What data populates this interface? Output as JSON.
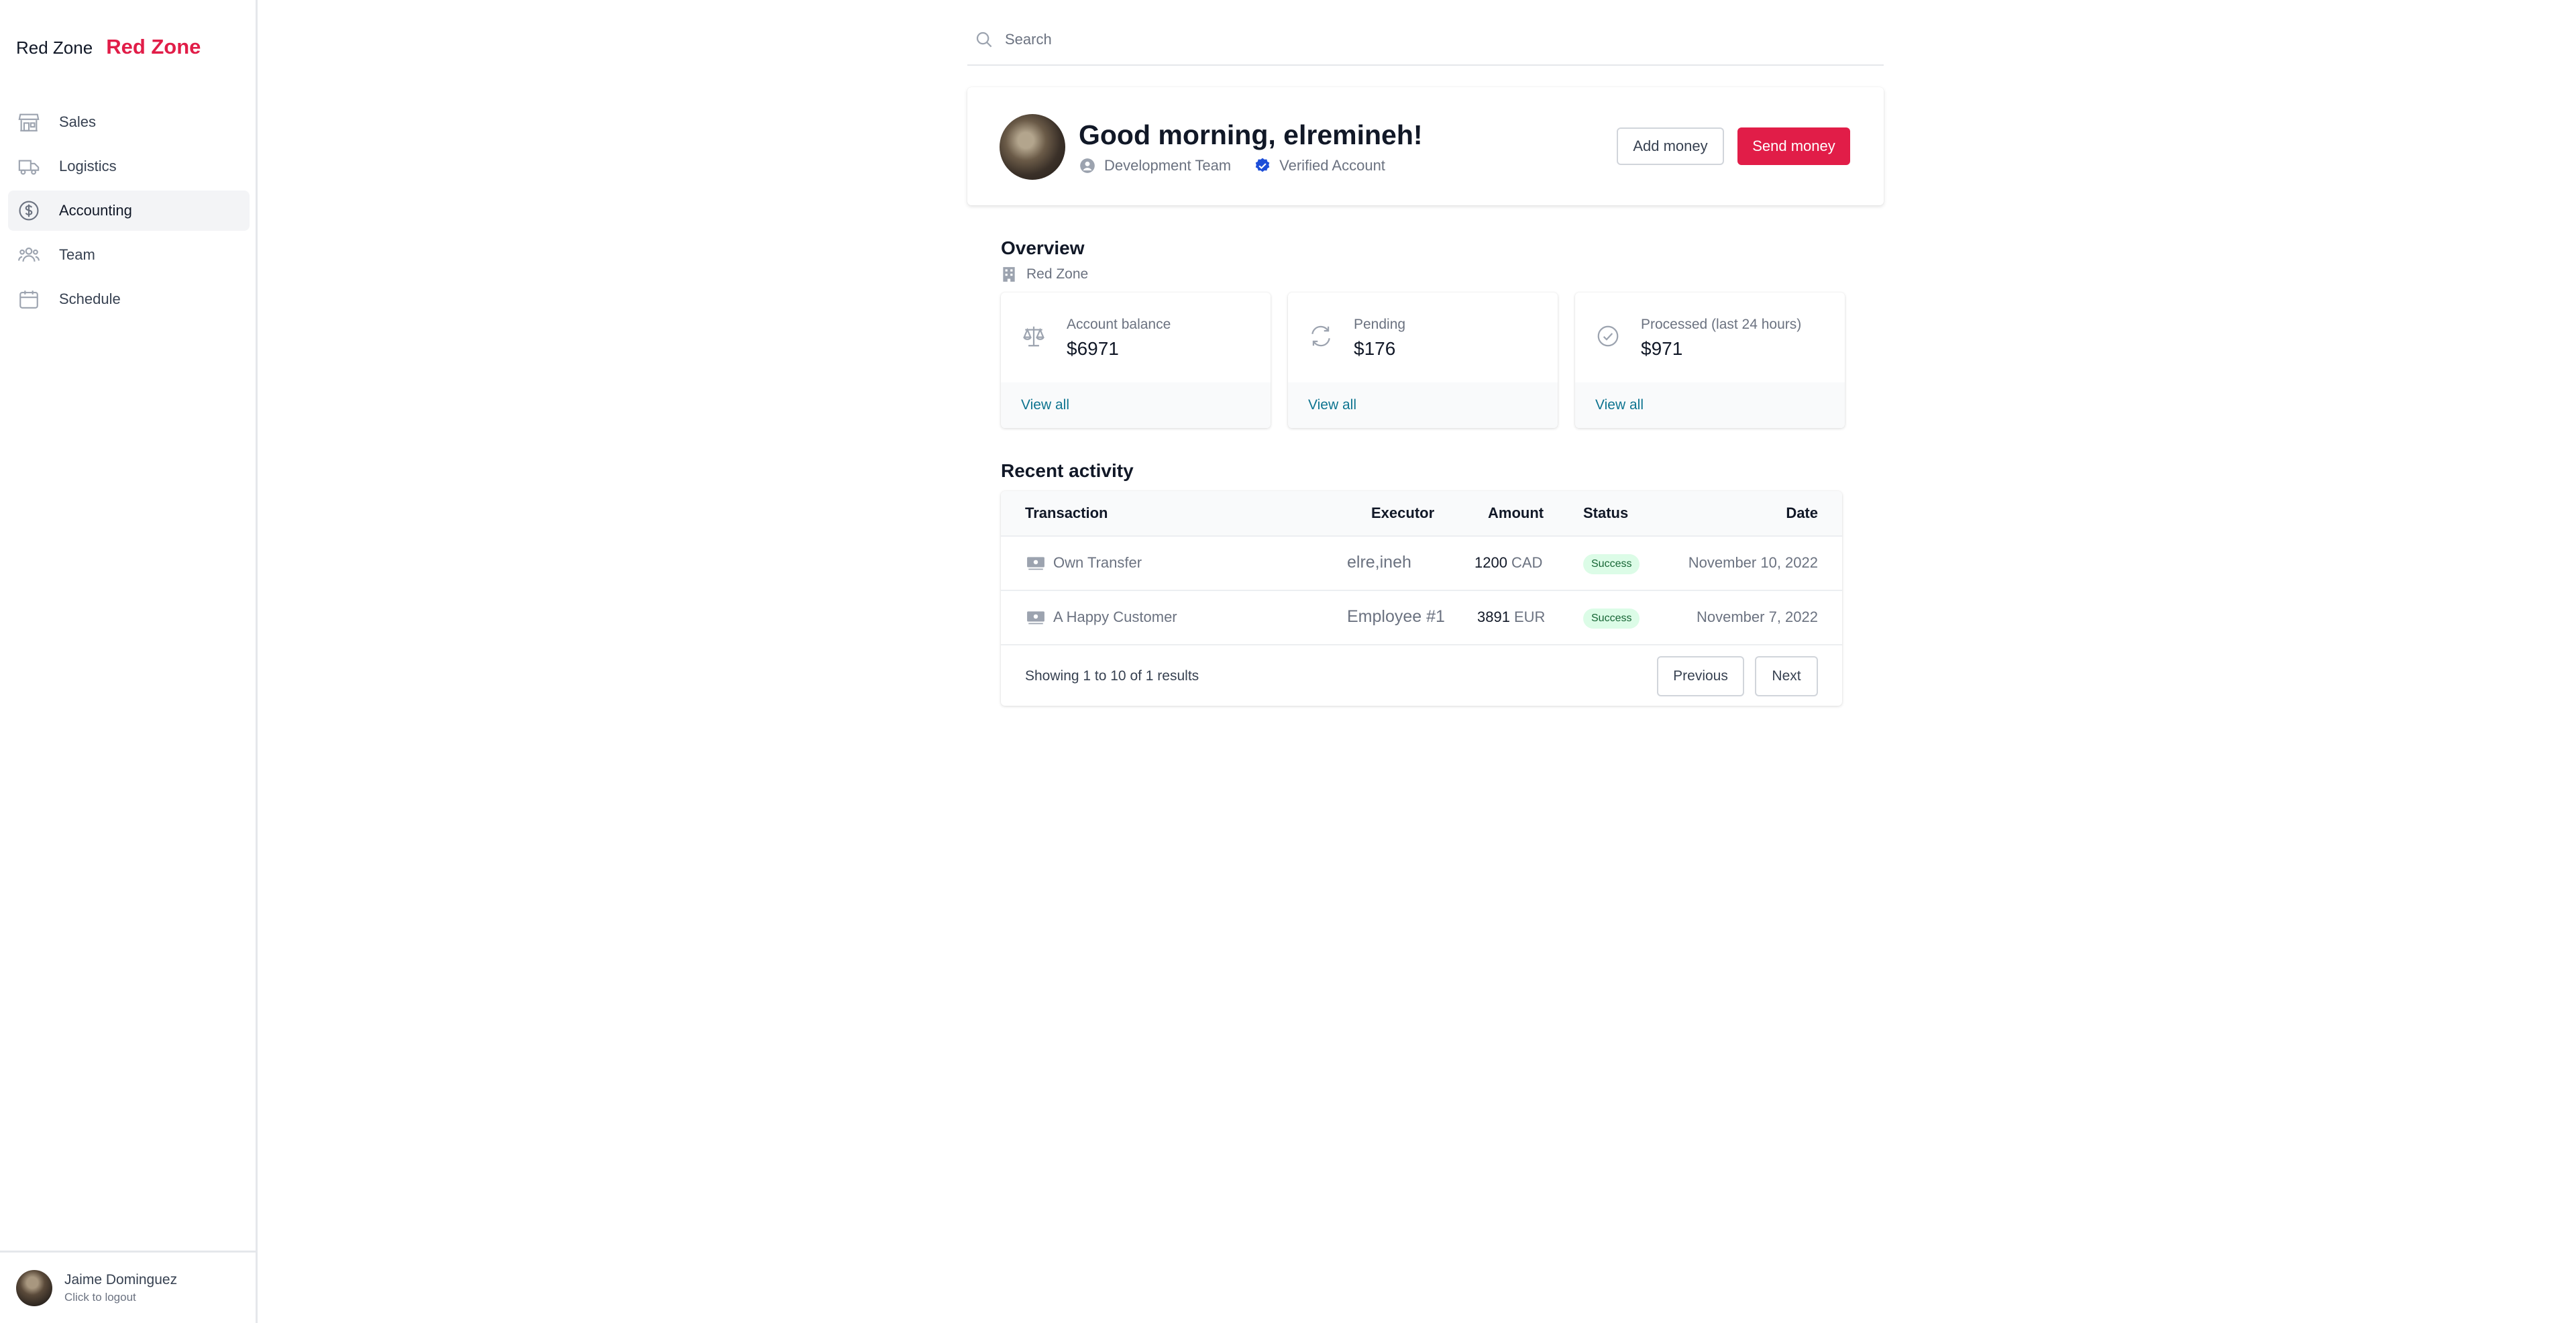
{
  "sidebar": {
    "brand_name": "Red Zone",
    "brand_logo": "Red Zone",
    "items": [
      {
        "label": "Sales",
        "icon": "store-icon"
      },
      {
        "label": "Logistics",
        "icon": "truck-icon"
      },
      {
        "label": "Accounting",
        "icon": "dollar-icon",
        "active": true
      },
      {
        "label": "Team",
        "icon": "users-icon"
      },
      {
        "label": "Schedule",
        "icon": "calendar-icon"
      }
    ],
    "user": {
      "name": "Jaime Dominguez",
      "subtitle": "Click to logout"
    }
  },
  "search": {
    "placeholder": "Search"
  },
  "greeting": {
    "title": "Good morning, elremineh!",
    "team": "Development Team",
    "verified": "Verified Account",
    "add_money": "Add money",
    "send_money": "Send money"
  },
  "overview": {
    "title": "Overview",
    "subtitle": "Red Zone",
    "cards": [
      {
        "label": "Account balance",
        "value": "$6971",
        "link": "View all",
        "icon": "scale-icon"
      },
      {
        "label": "Pending",
        "value": "$176",
        "link": "View all",
        "icon": "refresh-icon"
      },
      {
        "label": "Processed (last 24 hours)",
        "value": "$971",
        "link": "View all",
        "icon": "check-circle-icon"
      }
    ]
  },
  "activity": {
    "title": "Recent activity",
    "columns": {
      "transaction": "Transaction",
      "executor": "Executor",
      "amount": "Amount",
      "status": "Status",
      "date": "Date"
    },
    "rows": [
      {
        "transaction": "Own Transfer",
        "executor": "elre,ineh",
        "amount": "1200",
        "currency": "CAD",
        "status": "Success",
        "date": "November 10, 2022"
      },
      {
        "transaction": "A Happy Customer",
        "executor": "Employee #1",
        "amount": "3891",
        "currency": "EUR",
        "status": "Success",
        "date": "November 7, 2022"
      }
    ],
    "summary": "Showing 1 to 10 of 1 results",
    "prev": "Previous",
    "next": "Next"
  },
  "colors": {
    "accent": "#e11d48",
    "link": "#0e7490",
    "success_bg": "#dcfce7",
    "success_text": "#166534",
    "verified": "#1d4ed8"
  }
}
